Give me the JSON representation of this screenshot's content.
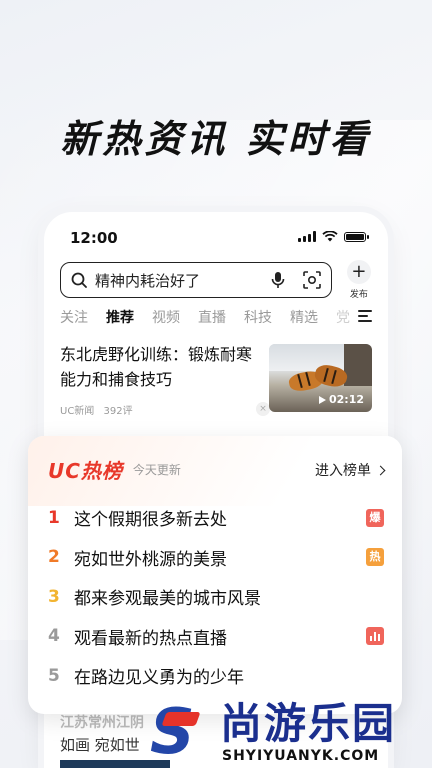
{
  "headline": "新热资讯 实时看",
  "status_bar": {
    "time": "12:00"
  },
  "search": {
    "query": "精神内耗治好了",
    "publish_label": "发布",
    "publish_symbol": "+"
  },
  "tabs": [
    "关注",
    "推荐",
    "视频",
    "直播",
    "科技",
    "精选",
    "党"
  ],
  "active_tab": "推荐",
  "article": {
    "title": "东北虎野化训练：锻炼耐寒能力和捕食技巧",
    "source": "UC新闻",
    "comments": "392评",
    "duration": "02:12"
  },
  "hot_list": {
    "logo": "UC热榜",
    "subtitle": "今天更新",
    "enter_label": "进入榜单",
    "items": [
      {
        "rank": "1",
        "text": "这个假期很多新去处",
        "badge": "爆",
        "badge_color": "#f0655b",
        "rank_color": "#e8382a"
      },
      {
        "rank": "2",
        "text": "宛如世外桃源的美景",
        "badge": "热",
        "badge_color": "#f5a03c",
        "rank_color": "#f07a28"
      },
      {
        "rank": "3",
        "text": "都来参观最美的城市风景",
        "badge": "",
        "badge_color": "",
        "rank_color": "#f2b431"
      },
      {
        "rank": "4",
        "text": "观看最新的热点直播",
        "badge": "chart-icon",
        "badge_color": "#f0655b",
        "rank_color": "#9a9a9a"
      },
      {
        "rank": "5",
        "text": "在路边见义勇为的少年",
        "badge": "",
        "badge_color": "",
        "rank_color": "#9a9a9a"
      }
    ]
  },
  "peek": {
    "line1": "江苏常州江阴",
    "line2": "如画 宛如世"
  },
  "watermark": {
    "title": "尚游乐园",
    "subtitle": "SHYIYUANYK.COM"
  },
  "colors": {
    "accent_red": "#e8382a",
    "brand_blue": "#1b2f8e"
  }
}
